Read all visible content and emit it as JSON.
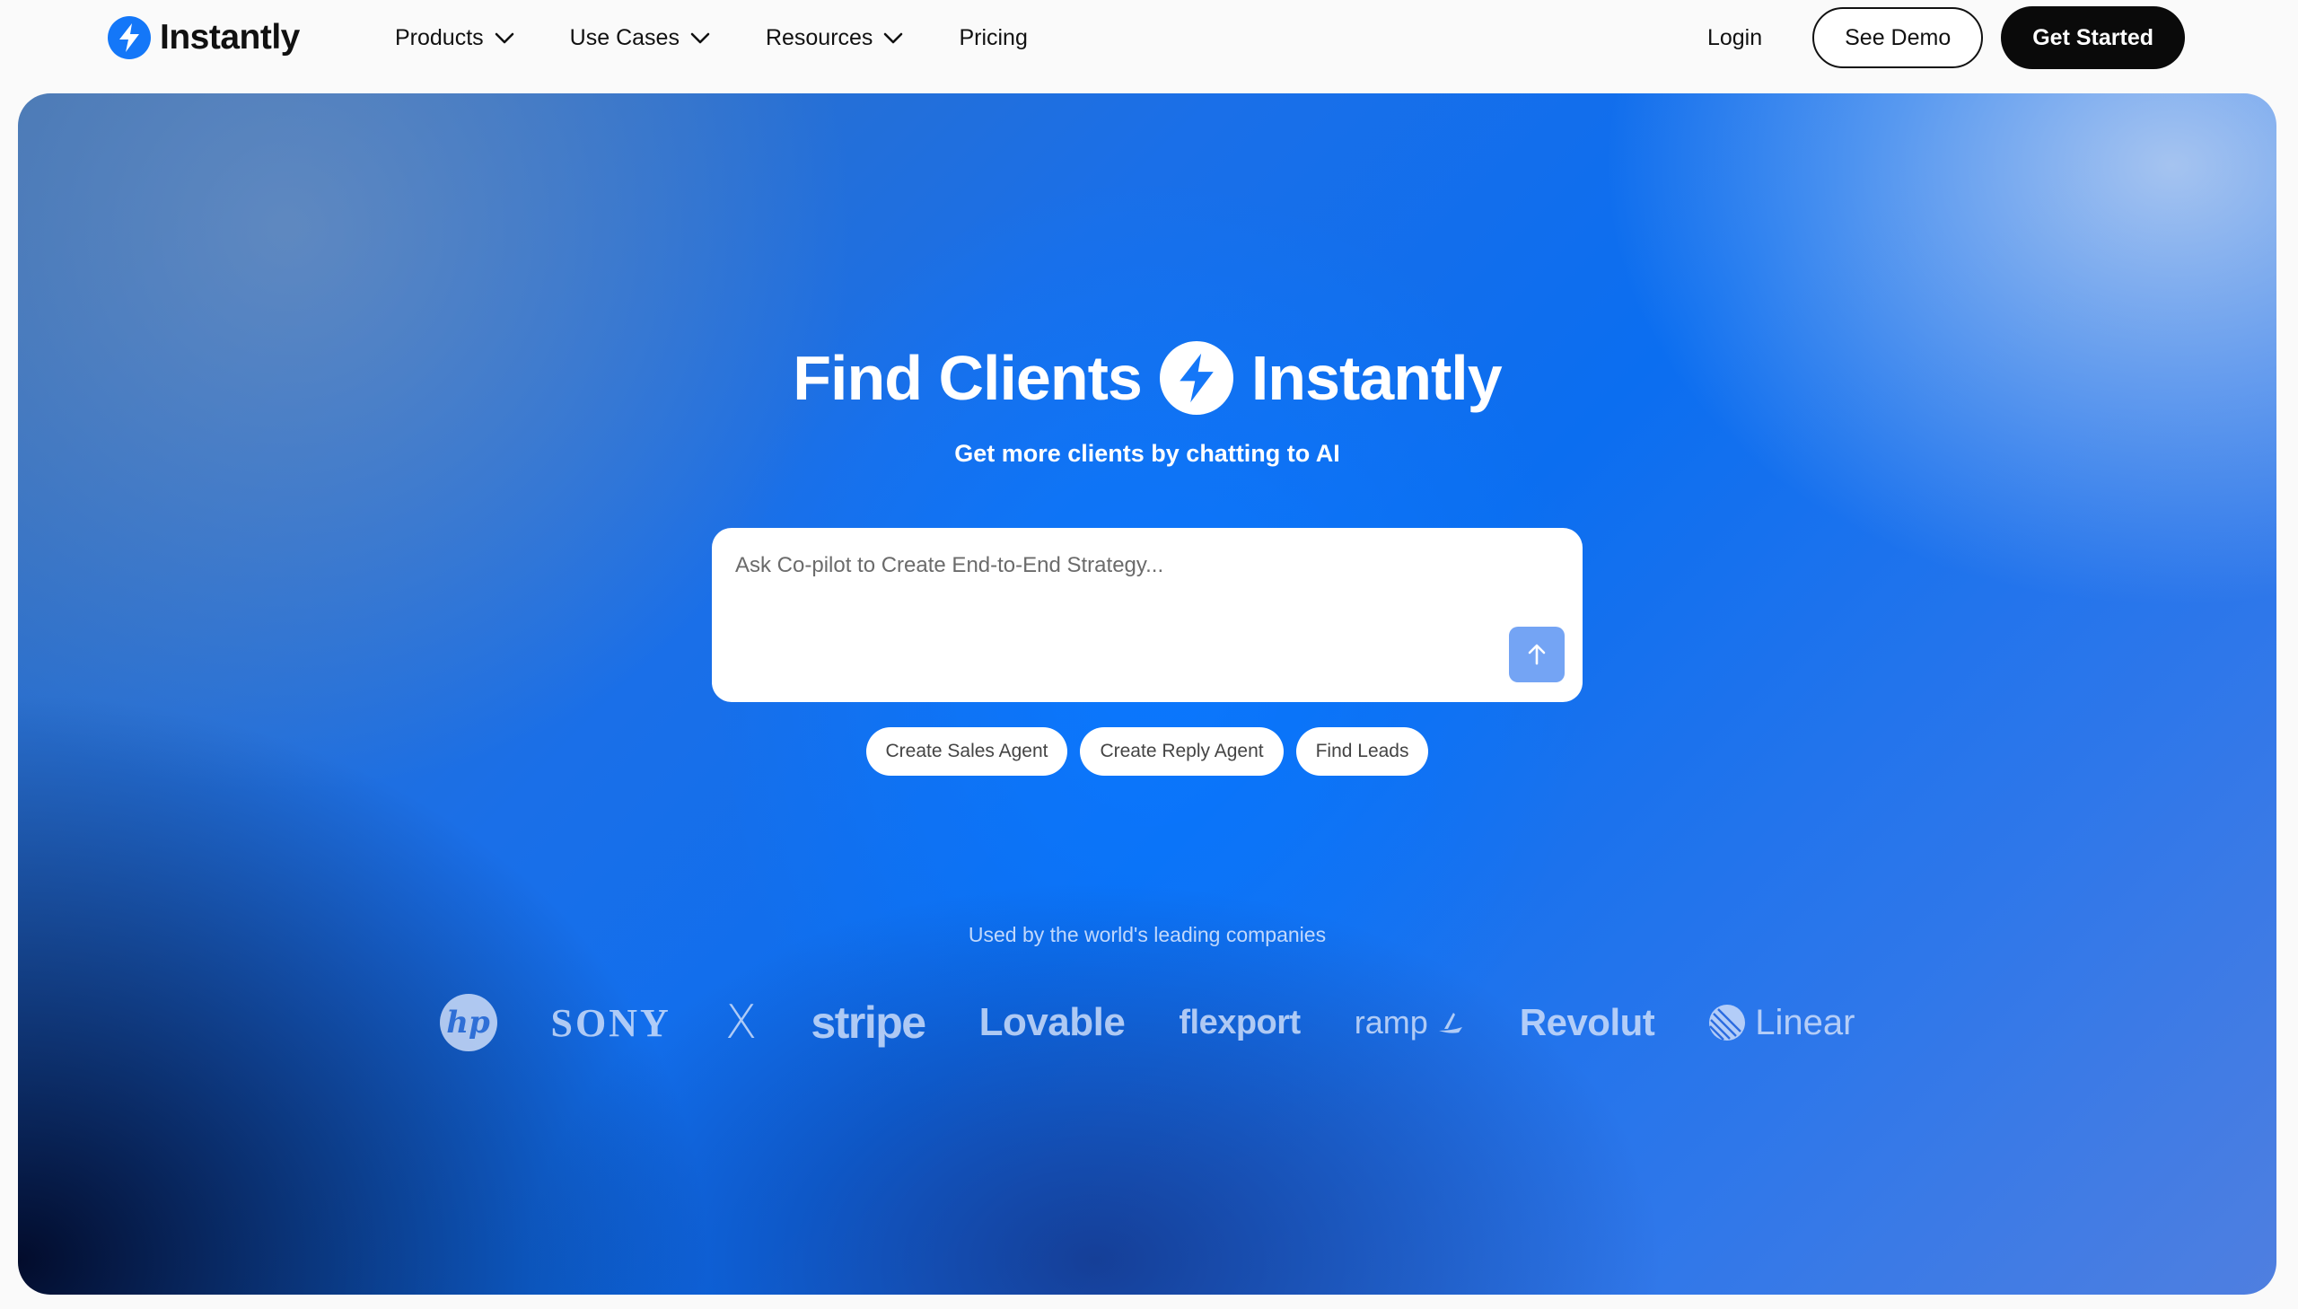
{
  "brand": {
    "name": "Instantly",
    "logo_icon": "lightning-bolt-icon",
    "accent": "#1477f8"
  },
  "nav": {
    "menu": [
      {
        "label": "Products",
        "has_dropdown": true
      },
      {
        "label": "Use Cases",
        "has_dropdown": true
      },
      {
        "label": "Resources",
        "has_dropdown": true
      },
      {
        "label": "Pricing",
        "has_dropdown": false
      }
    ],
    "login": "Login",
    "see_demo": "See Demo",
    "get_started": "Get Started"
  },
  "hero": {
    "headline_left": "Find Clients",
    "headline_right": "Instantly",
    "subheadline": "Get more clients by chatting to AI",
    "prompt": {
      "placeholder": "Ask Co-pilot to Create End-to-End Strategy...",
      "value": ""
    },
    "send_icon": "arrow-up-icon",
    "chips": [
      "Create Sales Agent",
      "Create Reply Agent",
      "Find Leads"
    ],
    "used_by": "Used by the world's leading companies",
    "logos": {
      "hp": "hp",
      "sony": "SONY",
      "x": "X",
      "stripe": "stripe",
      "lovable": "Lovable",
      "flexport": "flexport",
      "ramp": "ramp",
      "revolut": "Revolut",
      "linear": "Linear"
    }
  },
  "colors": {
    "primary_button": "#0a0a0a",
    "send_button": "#74a4f4",
    "hero_blue": "#0b6ef0"
  }
}
